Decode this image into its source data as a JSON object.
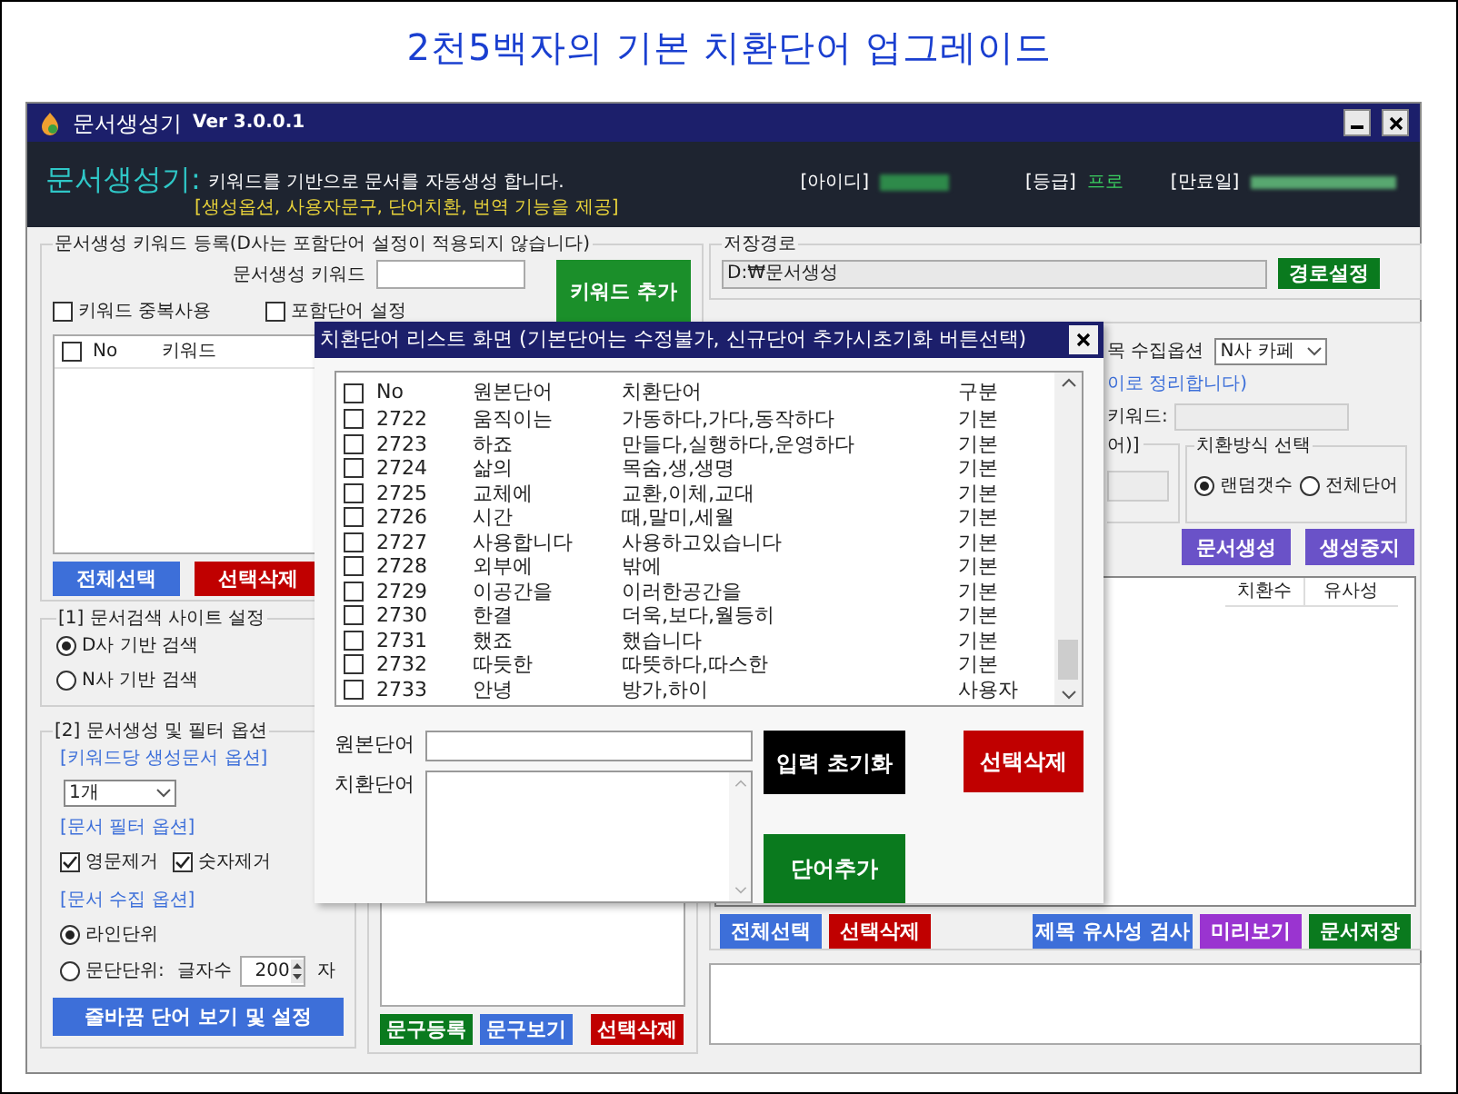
{
  "heading": "2천5백자의 기본 치환단어 업그레이드",
  "window": {
    "title": "문서생성기",
    "version": "Ver 3.0.0.1"
  },
  "header": {
    "app_name": "문서생성기:",
    "description": "키워드를 기반으로 문서를 자동생성 합니다.",
    "features": "[생성옵션, 사용자문구, 단어치환, 번역 기능을 제공]",
    "id_label": "[아이디]",
    "grade_label": "[등급]",
    "grade": "프로",
    "expiry_label": "[만료일]"
  },
  "keyword_group": {
    "legend": "문서생성 키워드 등록(D사는 포함단어 설정이 적용되지 않습니다)",
    "keyword_label": "문서생성 키워드",
    "add_button": "키워드 추가",
    "checkboxes": [
      {
        "label": "키워드 중복사용",
        "checked": false
      },
      {
        "label": "포함단어 설정",
        "checked": false
      }
    ],
    "select_all_checked": false,
    "columns": [
      "No",
      "키워드"
    ],
    "buttons": [
      {
        "label": "전체선택",
        "color": "#3d6fd9"
      },
      {
        "label": "선택삭제",
        "color": "#c00000"
      }
    ]
  },
  "site_group": {
    "legend": "[1] 문서검색 사이트 설정",
    "options": [
      {
        "label": "D사 기반 검색",
        "selected": true
      },
      {
        "label": "N사 기반 검색",
        "selected": false
      }
    ]
  },
  "options_group": {
    "legend": "[2] 문서생성 및 필터 옵션",
    "per_keyword_label": "[키워드당 생성문서 옵션]",
    "count_select": "1개",
    "filter_label": "[문서 필터 옵션]",
    "filters": [
      {
        "label": "영문제거",
        "checked": true
      },
      {
        "label": "숫자제거",
        "checked": true
      }
    ],
    "collect_label": "[문서 수집 옵션]",
    "collect_options": [
      {
        "label": "라인단위",
        "selected": true
      },
      {
        "label": "문단단위:",
        "selected": false
      }
    ],
    "char_count_label": "글자수",
    "char_count": "200",
    "char_unit": "자",
    "linebreak_button": "줄바꿈 단어 보기 및 설정"
  },
  "phrase_panel": {
    "buttons": [
      {
        "label": "문구등록",
        "color": "#0a7a1e"
      },
      {
        "label": "문구보기",
        "color": "#3d6fd9"
      },
      {
        "label": "선택삭제",
        "color": "#c00000"
      }
    ]
  },
  "save_path": {
    "legend": "저장경로",
    "path": "D:₩문서생성",
    "button": "경로설정"
  },
  "generate_panel": {
    "collect_label": "목 수집옵션",
    "collect_select": "N사 카페",
    "note": "이로 정리합니다)",
    "keyword_label": "키워드:",
    "group_legend": "어)]",
    "replace_mode": {
      "legend": "치환방식 선택",
      "options": [
        {
          "label": "랜덤갯수",
          "selected": true
        },
        {
          "label": "전체단어",
          "selected": false
        }
      ]
    },
    "buttons": [
      {
        "label": "문서생성",
        "color": "#6a52c8"
      },
      {
        "label": "생성중지",
        "color": "#6a52c8"
      }
    ],
    "columns": [
      "치환수",
      "유사성"
    ],
    "bottom_buttons": [
      {
        "label": "전체선택",
        "color": "#3d6fd9"
      },
      {
        "label": "선택삭제",
        "color": "#c00000"
      },
      {
        "label": "제목 유사성 검사",
        "color": "#3d6fd9"
      },
      {
        "label": "미리보기",
        "color": "#9a34d0"
      },
      {
        "label": "문서저장",
        "color": "#0a7a1e"
      }
    ]
  },
  "dialog": {
    "title": "치환단어 리스트 화면 (기본단어는 수정불가, 신규단어 추가시초기화 버튼선택)",
    "select_all_checked": false,
    "columns": [
      "No",
      "원본단어",
      "치환단어",
      "구분"
    ],
    "rows": [
      {
        "no": "2722",
        "original": "움직이는",
        "replacement": "가동하다,가다,동작하다",
        "type": "기본",
        "checked": false
      },
      {
        "no": "2723",
        "original": "하죠",
        "replacement": "만들다,실행하다,운영하다",
        "type": "기본",
        "checked": false
      },
      {
        "no": "2724",
        "original": "삶의",
        "replacement": "목숨,생,생명",
        "type": "기본",
        "checked": false
      },
      {
        "no": "2725",
        "original": "교체에",
        "replacement": "교환,이체,교대",
        "type": "기본",
        "checked": false
      },
      {
        "no": "2726",
        "original": "시간",
        "replacement": "때,말미,세월",
        "type": "기본",
        "checked": false
      },
      {
        "no": "2727",
        "original": "사용합니다",
        "replacement": "사용하고있습니다",
        "type": "기본",
        "checked": false
      },
      {
        "no": "2728",
        "original": "외부에",
        "replacement": "밖에",
        "type": "기본",
        "checked": false
      },
      {
        "no": "2729",
        "original": "이공간을",
        "replacement": "이러한공간을",
        "type": "기본",
        "checked": false
      },
      {
        "no": "2730",
        "original": "한결",
        "replacement": "더욱,보다,월등히",
        "type": "기본",
        "checked": false
      },
      {
        "no": "2731",
        "original": "했죠",
        "replacement": "했습니다",
        "type": "기본",
        "checked": false
      },
      {
        "no": "2732",
        "original": "따듯한",
        "replacement": "따뜻하다,따스한",
        "type": "기본",
        "checked": false
      },
      {
        "no": "2733",
        "original": "안녕",
        "replacement": "방가,하이",
        "type": "사용자",
        "checked": false
      }
    ],
    "original_label": "원본단어",
    "replacement_label": "치환단어",
    "reset_button": "입력 초기화",
    "delete_button": "선택삭제",
    "add_button": "단어추가"
  }
}
